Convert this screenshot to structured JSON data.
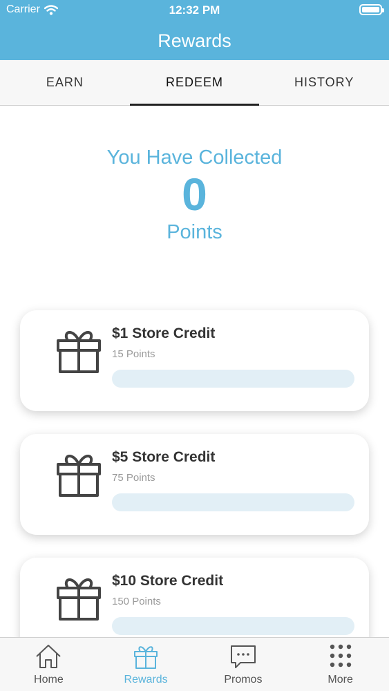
{
  "status_bar": {
    "carrier": "Carrier",
    "time": "12:32 PM",
    "icons": [
      "wifi-icon",
      "battery-icon"
    ]
  },
  "nav": {
    "title": "Rewards"
  },
  "tabs": [
    {
      "label": "EARN",
      "active": false
    },
    {
      "label": "REDEEM",
      "active": true
    },
    {
      "label": "HISTORY",
      "active": false
    }
  ],
  "points": {
    "heading": "You Have Collected",
    "value": "0",
    "unit": "Points"
  },
  "rewards": [
    {
      "title": "$1 Store Credit",
      "cost": "15 Points",
      "icon": "gift-icon",
      "progress": 0
    },
    {
      "title": "$5 Store Credit",
      "cost": "75 Points",
      "icon": "gift-icon",
      "progress": 0
    },
    {
      "title": "$10 Store Credit",
      "cost": "150 Points",
      "icon": "gift-icon",
      "progress": 0
    }
  ],
  "tabbar": [
    {
      "label": "Home",
      "icon": "home-icon",
      "active": false
    },
    {
      "label": "Rewards",
      "icon": "gift-icon",
      "active": true
    },
    {
      "label": "Promos",
      "icon": "chat-bubble-icon",
      "active": false
    },
    {
      "label": "More",
      "icon": "grid-dots-icon",
      "active": false
    }
  ],
  "colors": {
    "accent": "#5ab4dc",
    "track": "#e2eff6",
    "text_dark": "#333333",
    "text_muted": "#999999"
  }
}
